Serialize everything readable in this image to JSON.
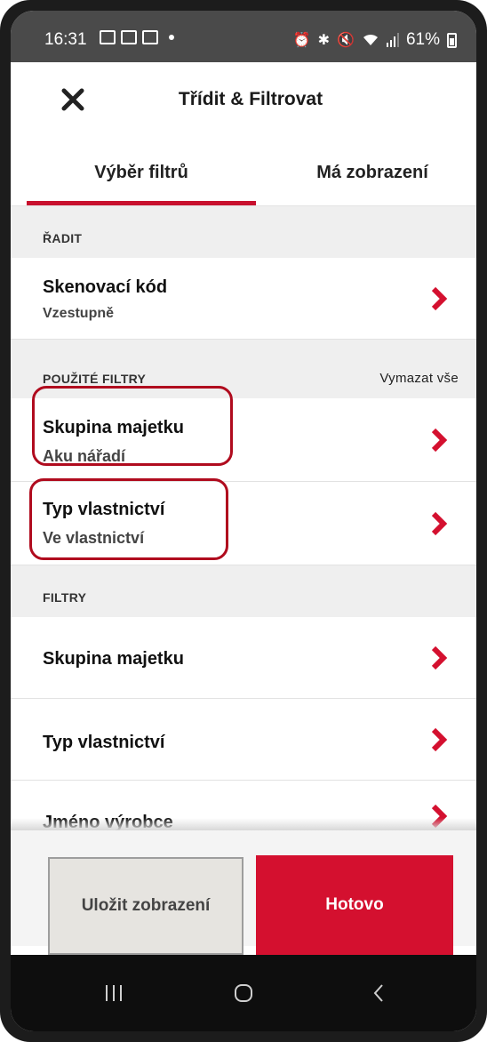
{
  "status_bar": {
    "time": "16:31",
    "battery": "61%"
  },
  "header": {
    "title": "Třídit & Filtrovat"
  },
  "tabs": [
    {
      "label": "Výběr filtrů",
      "active": true
    },
    {
      "label": "Má zobrazení",
      "active": false
    }
  ],
  "sort": {
    "section_label": "ŘADIT",
    "item": {
      "title": "Skenovací kód",
      "value": "Vzestupně"
    }
  },
  "applied_filters": {
    "section_label": "POUŽITÉ FILTRY",
    "clear_all": "Vymazat vše",
    "items": [
      {
        "title": "Skupina majetku",
        "value": "Aku nářadí"
      },
      {
        "title": "Typ vlastnictví",
        "value": "Ve vlastnictví"
      }
    ]
  },
  "filters": {
    "section_label": "FILTRY",
    "items": [
      {
        "title": "Skupina majetku"
      },
      {
        "title": "Typ vlastnictví"
      },
      {
        "title": "Jméno výrobce"
      }
    ]
  },
  "buttons": {
    "save_view": "Uložit zobrazení",
    "done": "Hotovo"
  },
  "colors": {
    "accent": "#c8102e",
    "section_bg": "#efefef",
    "done_button": "#d4102f"
  }
}
